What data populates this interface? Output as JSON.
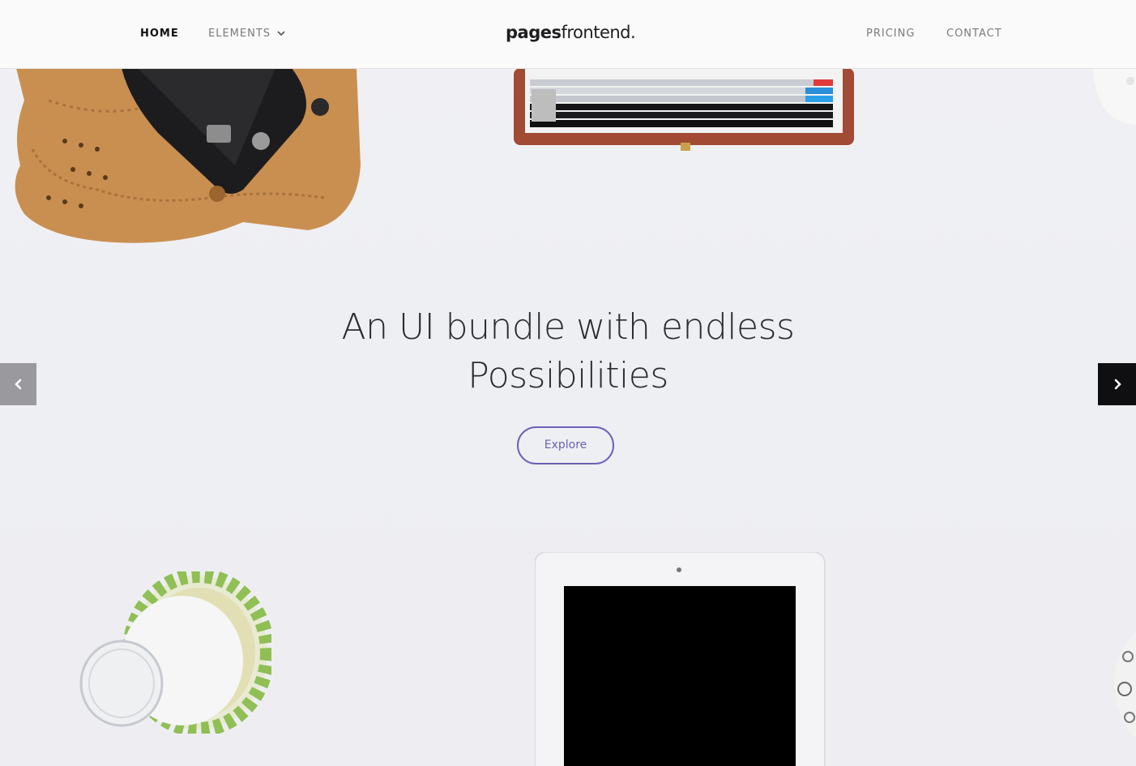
{
  "nav": {
    "home": "HOME",
    "elements": "ELEMENTS",
    "pricing": "PRICING",
    "contact": "CONTACT"
  },
  "logo": {
    "bold": "pages",
    "light": "frontend."
  },
  "hero": {
    "line1": "An UI bundle with endless",
    "line2": "Possibilities",
    "cta": "Explore"
  },
  "icons": {
    "chevron": "chevron-down-icon",
    "prev": "chevron-left-icon",
    "next": "chevron-right-icon"
  },
  "colors": {
    "accent": "#6c5fb8",
    "text_dark": "#2b2b30",
    "header_bg": "#fafafa"
  }
}
